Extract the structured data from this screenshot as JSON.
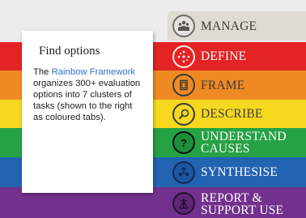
{
  "card": {
    "title": "Find options",
    "text_before": "The ",
    "link": "Rainbow Framework",
    "text_after": " organizes 300+ evaluation options into 7 clusters of tasks (shown to the right as coloured tabs)."
  },
  "tabs": [
    {
      "label": "MANAGE",
      "icon": "people-group-icon",
      "color": "#dedbd3",
      "text_color": "#3b3b3b"
    },
    {
      "label": "DEFINE",
      "icon": "dotted-circle-icon",
      "color": "#e42325",
      "text_color": "#ffffff"
    },
    {
      "label": "FRAME",
      "icon": "frame-icon",
      "color": "#ef8a22",
      "text_color": "#3b3b3b"
    },
    {
      "label": "DESCRIBE",
      "icon": "magnifier-icon",
      "color": "#f6d81f",
      "text_color": "#3b3b3b"
    },
    {
      "label": "UNDERSTAND\nCAUSES",
      "icon": "question-mark-icon",
      "color": "#25a244",
      "text_color": "#ffffff"
    },
    {
      "label": "SYNTHESISE",
      "icon": "synthesis-icon",
      "color": "#2263b2",
      "text_color": "#ffffff"
    },
    {
      "label": "REPORT &\nSUPPORT USE",
      "icon": "tower-icon",
      "color": "#73318e",
      "text_color": "#ffffff"
    }
  ]
}
